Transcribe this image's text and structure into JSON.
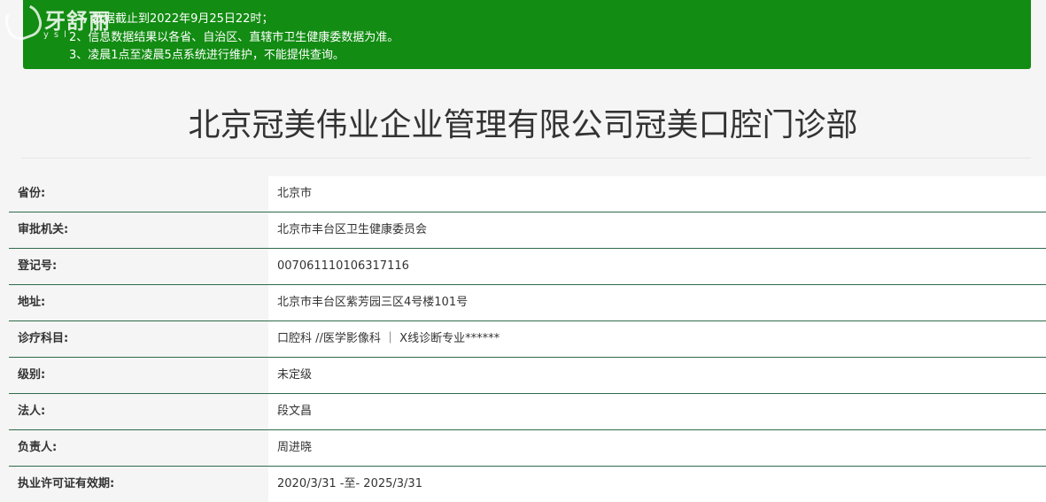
{
  "watermark": {
    "name": "牙舒丽",
    "sub": "ysl"
  },
  "notice": {
    "lines": [
      "数据截止到2022年9月25日22时；",
      "2、信息数据结果以各省、自治区、直辖市卫生健康委数据为准。",
      "3、凌晨1点至凌晨5点系统进行维护，不能提供查询。"
    ]
  },
  "title": "北京冠美伟业企业管理有限公司冠美口腔门诊部",
  "rows": [
    {
      "label": "省份:",
      "value": "北京市"
    },
    {
      "label": "审批机关:",
      "value": "北京市丰台区卫生健康委员会"
    },
    {
      "label": "登记号:",
      "value": "007061110106317116"
    },
    {
      "label": "地址:",
      "value": "北京市丰台区紫芳园三区4号楼101号"
    },
    {
      "label": "诊疗科目:",
      "value": "口腔科 //医学影像科 ｜ X线诊断专业******"
    },
    {
      "label": "级别:",
      "value": "未定级"
    },
    {
      "label": "法人:",
      "value": "段文昌"
    },
    {
      "label": "负责人:",
      "value": "周进晓"
    },
    {
      "label": "执业许可证有效期:",
      "value": "2020/3/31 -至- 2025/3/31"
    }
  ],
  "colors": {
    "notice_bg": "#128c12",
    "row_divider": "#2e6b4a",
    "page_bg": "#f5f5f5"
  }
}
